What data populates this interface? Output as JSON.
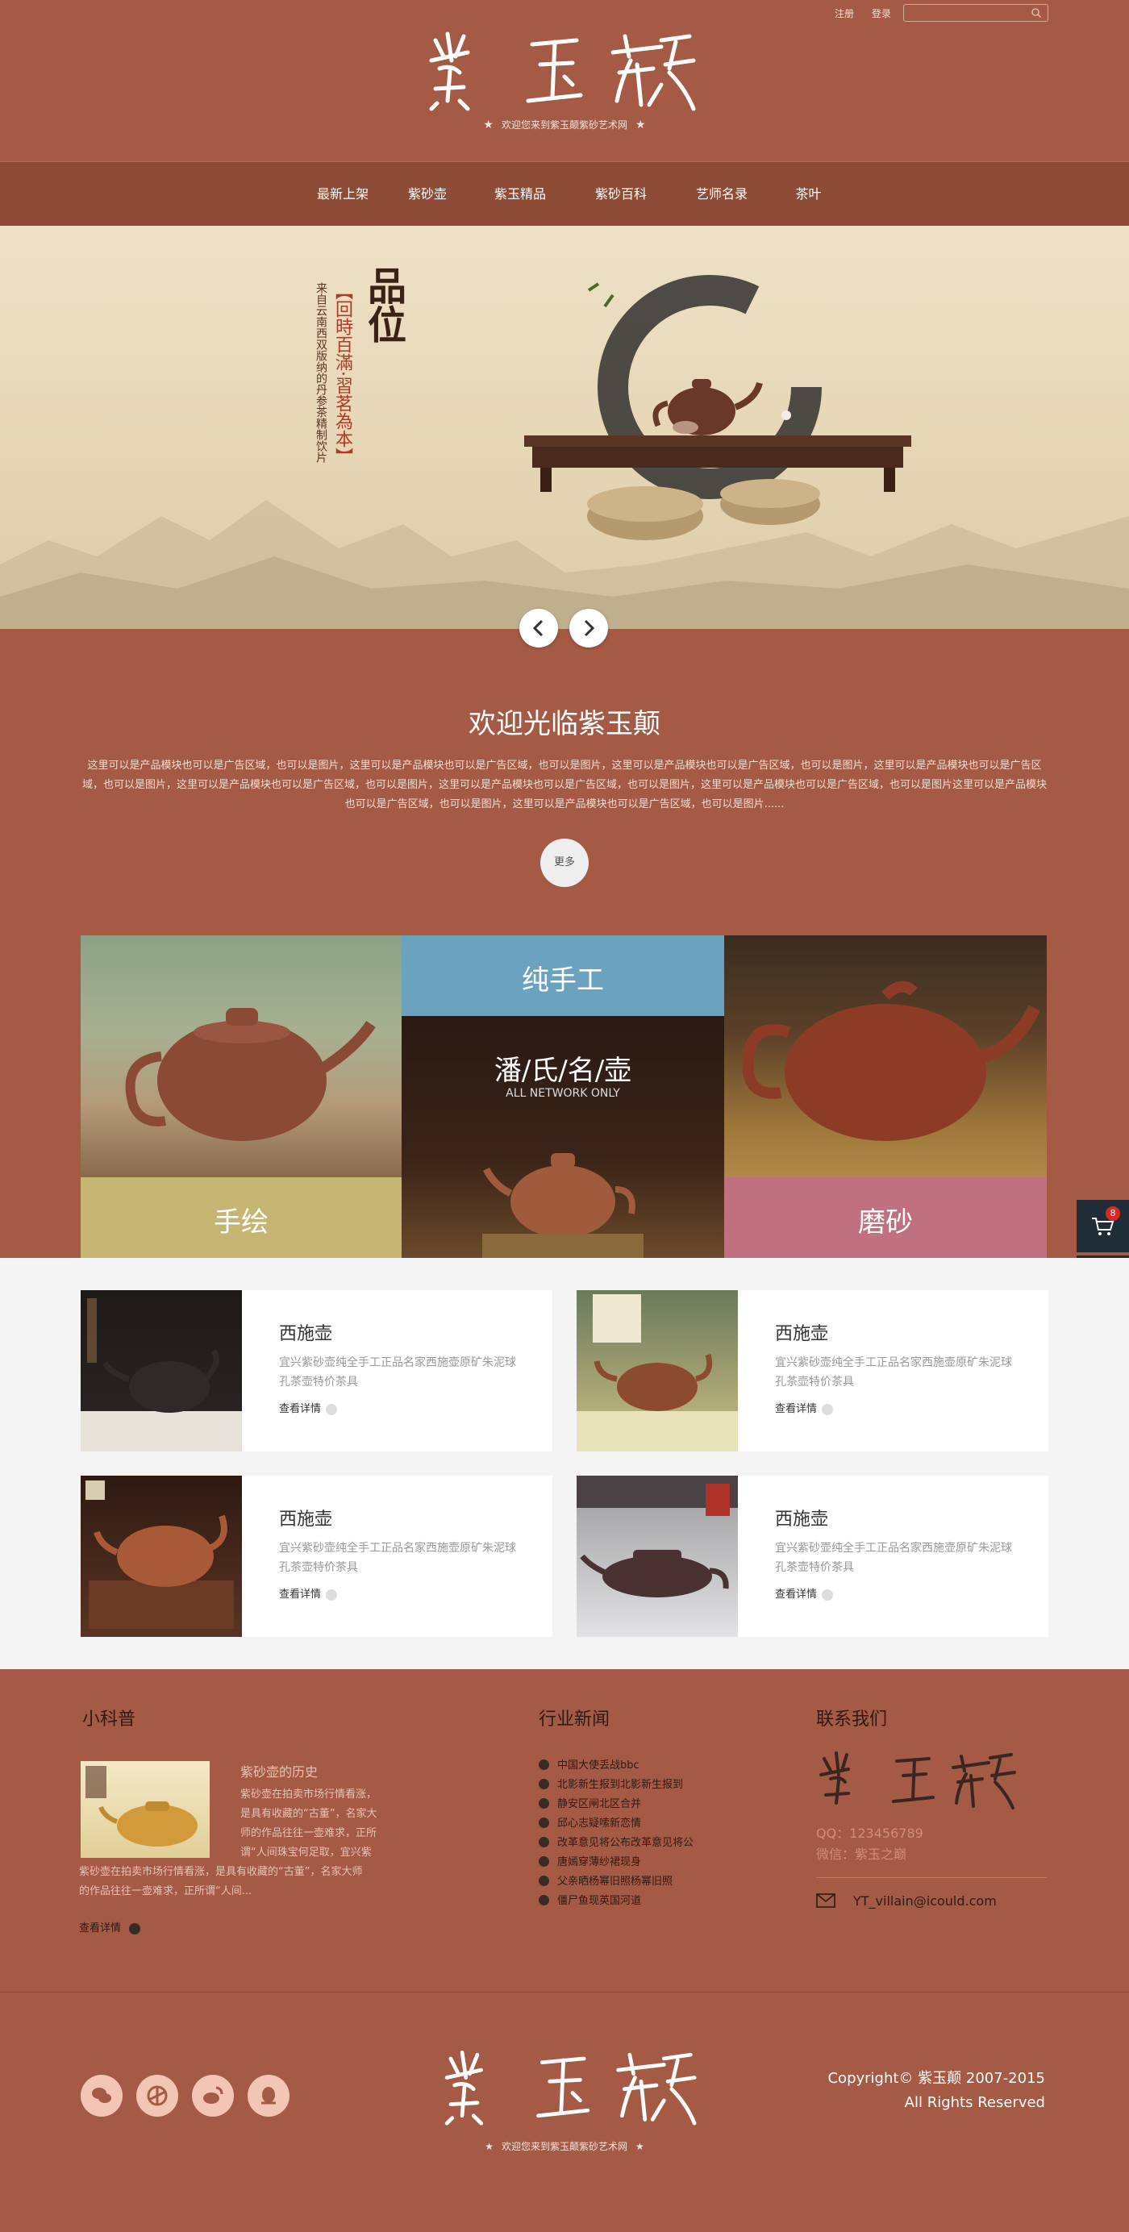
{
  "header": {
    "register": "注册",
    "login": "登录",
    "search_placeholder": "",
    "tagline": "欢迎您来到紫玉颠紫砂艺术网"
  },
  "nav": {
    "items": [
      "最新上架",
      "紫砂壶",
      "紫玉精品",
      "紫砂百科",
      "艺师名录",
      "茶叶"
    ]
  },
  "banner": {
    "big_text": "品位",
    "quote": "【回時百滿·習茗為本】",
    "sub": "来自云南西双版纳的丹参茶精制饮片"
  },
  "welcome": {
    "title": "欢迎光临紫玉颠",
    "text": "这里可以是产品模块也可以是广告区域，也可以是图片，这里可以是产品模块也可以是广告区域，也可以是图片，这里可以是产品模块也可以是广告区域，也可以是图片，这里可以是产品模块也可以是广告区域，也可以是图片，这里可以是产品模块也可以是广告区域，也可以是图片，这里可以是产品模块也可以是广告区域，也可以是图片，这里可以是产品模块也可以是广告区域，也可以是图片这里可以是产品模块也可以是广告区域，也可以是图片，这里可以是产品模块也可以是广告区域，也可以是图片......",
    "more": "更多"
  },
  "showcase": {
    "handmade": "纯手工",
    "pan_title": "潘/氏/名/壶",
    "pan_sub": "ALL NETWORK ONLY",
    "painted": "手绘",
    "frosted": "磨砂"
  },
  "cart": {
    "count": "8"
  },
  "products": [
    {
      "title": "西施壶",
      "desc": "宜兴紫砂壶纯全手工正品名家西施壶原矿朱泥球孔茶壶特价茶具",
      "detail": "查看详情"
    },
    {
      "title": "西施壶",
      "desc": "宜兴紫砂壶纯全手工正品名家西施壶原矿朱泥球孔茶壶特价茶具",
      "detail": "查看详情"
    },
    {
      "title": "西施壶",
      "desc": "宜兴紫砂壶纯全手工正品名家西施壶原矿朱泥球孔茶壶特价茶具",
      "detail": "查看详情"
    },
    {
      "title": "西施壶",
      "desc": "宜兴紫砂壶纯全手工正品名家西施壶原矿朱泥球孔茶壶特价茶具",
      "detail": "查看详情"
    }
  ],
  "science": {
    "title": "小科普",
    "article_title": "紫砂壶的历史",
    "article_text_1": "紫砂壶在拍卖市场行情看涨，",
    "article_text_2": "是具有收藏的“古董”，名家大",
    "article_text_3": "师的作品往往一壶难求，正所",
    "article_text_4": "谓“人间珠宝何足取，宜兴紫",
    "article_text_5": "紫砂壶在拍卖市场行情看涨，是具有收藏的“古董”，名家大师",
    "article_text_6": "的作品往往一壶难求，正所谓“人间...",
    "detail": "查看详情"
  },
  "news": {
    "title": "行业新闻",
    "items": [
      "中国大使丢战bbc",
      "北影新生报到北影新生报到",
      "静安区闸北区合并",
      "邱心志疑嗦新恋情",
      "改革意见将公布改革意见将公",
      "唐嫣穿薄纱裙现身",
      "父亲晒杨幂旧照杨幂旧照",
      "僵尸鱼现英国河道"
    ]
  },
  "contact": {
    "title": "联系我们",
    "qq": "QQ：123456789",
    "wechat": "微信：紫玉之巅",
    "email": "YT_villain@icould.com"
  },
  "footer": {
    "tagline": "欢迎您来到紫玉颠紫砂艺术网",
    "copyright": "Copyright© 紫玉颠 2007-2015",
    "rights": "All Rights Reserved",
    "social_icons": [
      "wechat-icon",
      "camera-icon",
      "weibo-icon",
      "qq-icon"
    ]
  },
  "colors": {
    "primary": "#a45a45",
    "nav": "#8e4b36",
    "blue_tile": "#6aa2c0",
    "olive_tile": "#c6b572",
    "pink_tile": "#c0707e",
    "cart": "#1f2d36"
  }
}
